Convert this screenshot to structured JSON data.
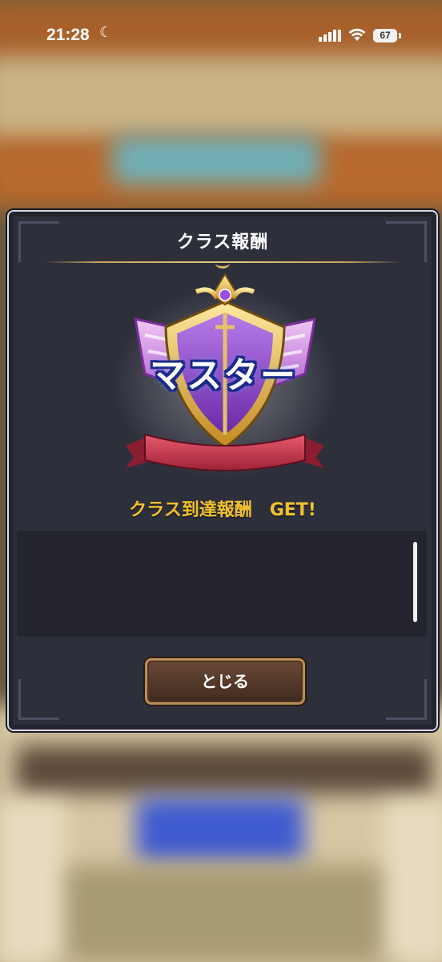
{
  "status_bar": {
    "time": "21:28",
    "battery": "67"
  },
  "dialog": {
    "title": "クラス報酬",
    "emblem_text": "マスター",
    "reward_message": "クラス到達報酬　GET!",
    "close_label": "とじる"
  },
  "colors": {
    "dialog_bg": "#2d2f3b",
    "reward_text": "#f1c02e",
    "emblem_purple": "#8a3fd1",
    "emblem_gold": "#d9a93a",
    "ribbon_red": "#c9344a",
    "button_brown": "#5a3d2c"
  }
}
